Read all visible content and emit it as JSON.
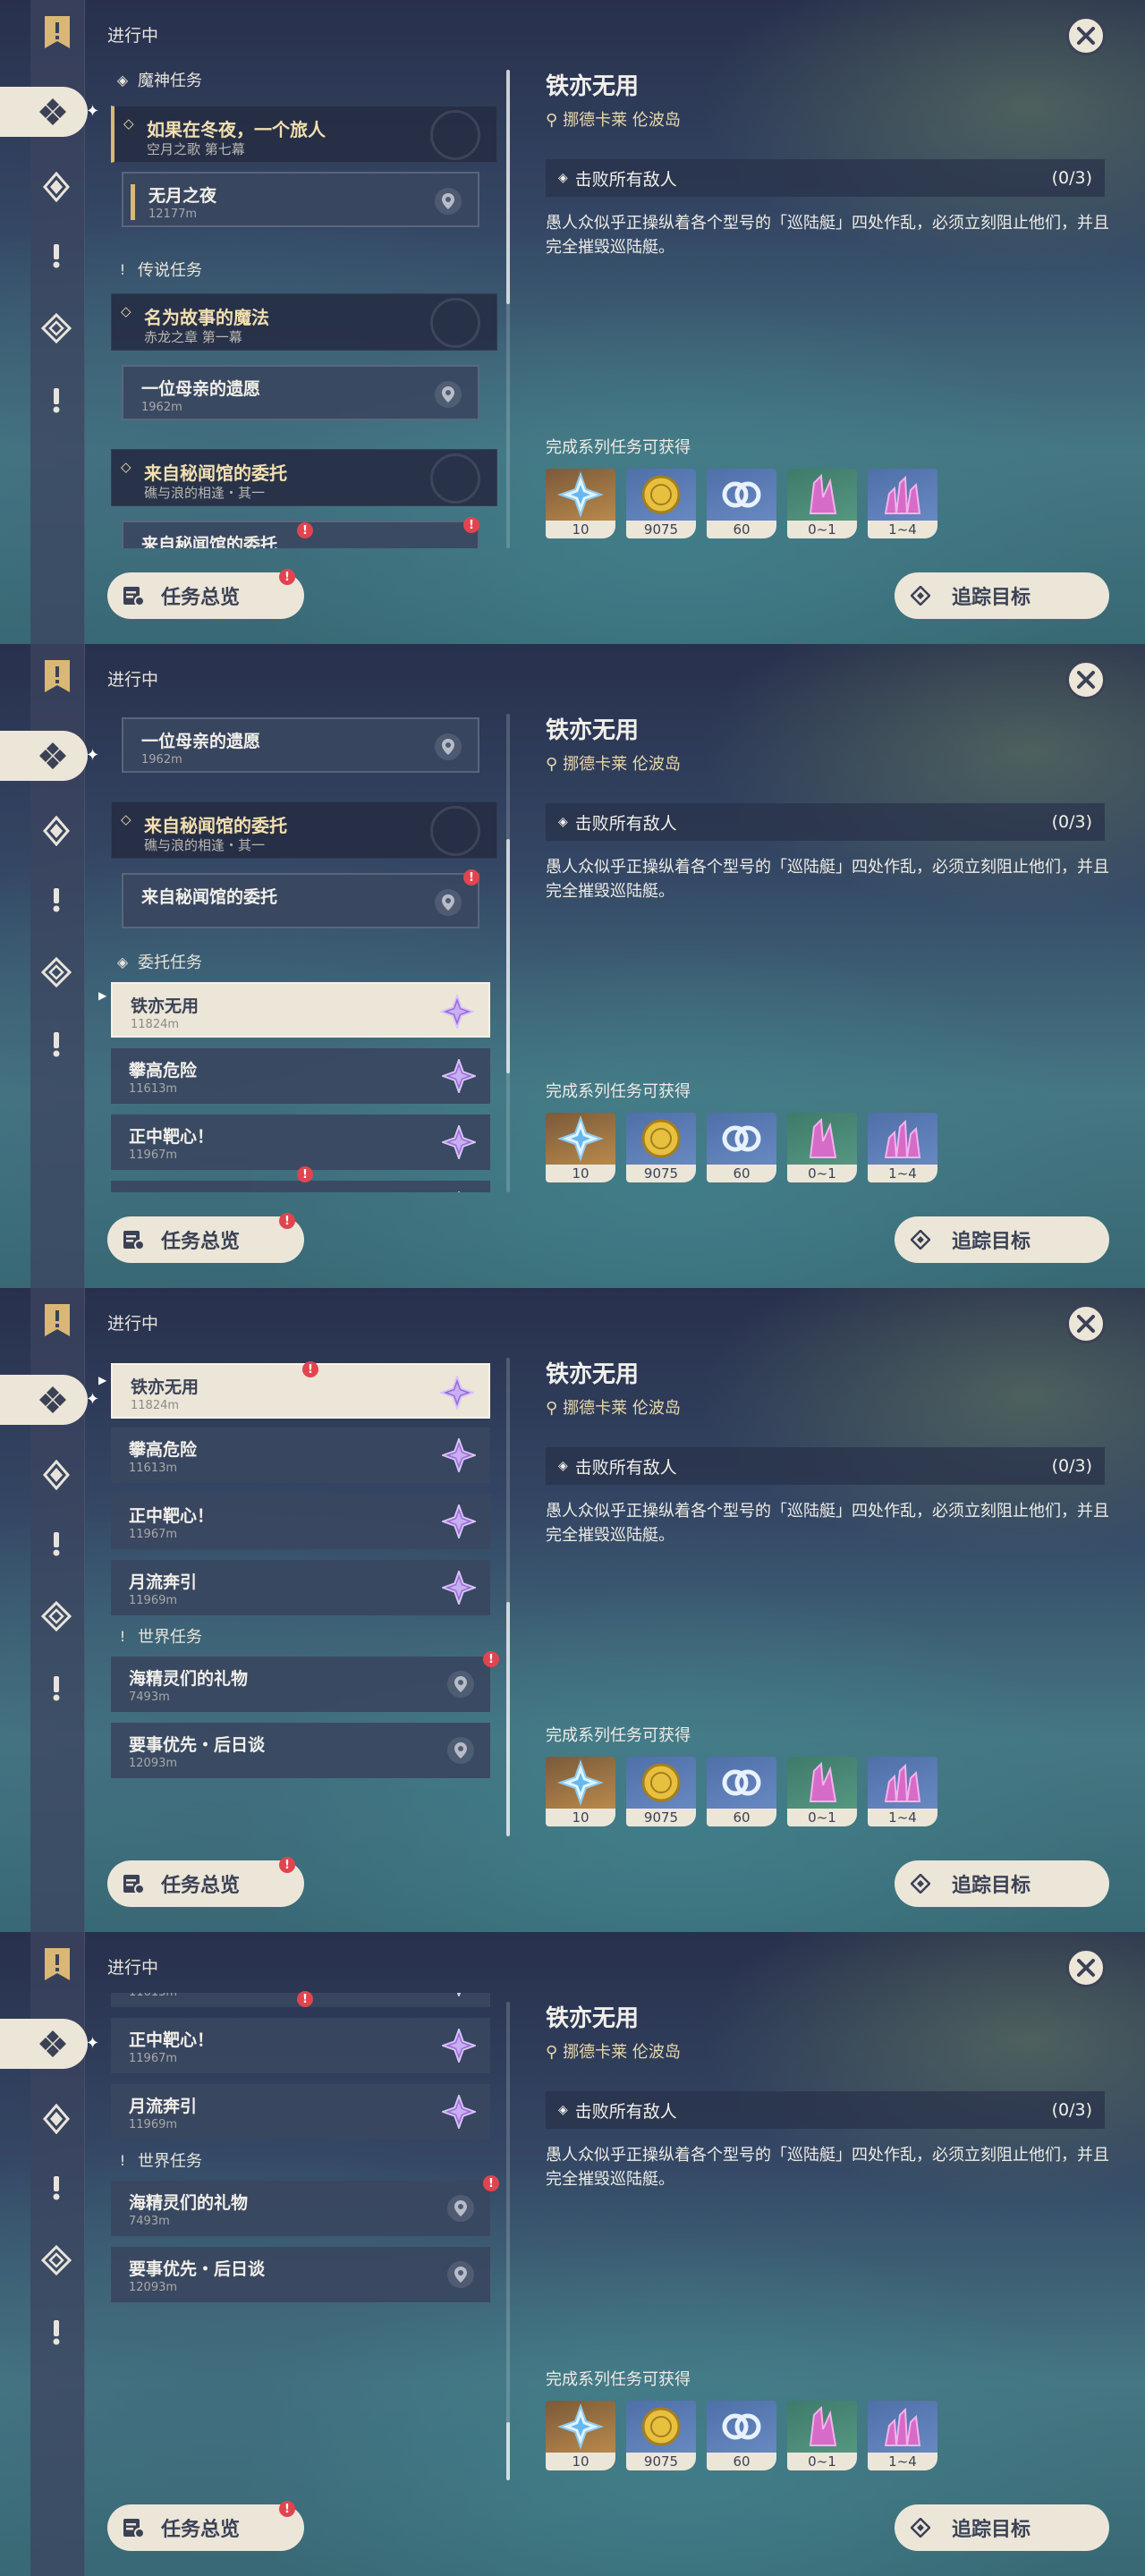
{
  "header": {
    "in_progress": "进行中"
  },
  "sections": {
    "archon": "魔神任务",
    "story": "传说任务",
    "commission": "委托任务",
    "world": "世界任务"
  },
  "quests": {
    "archon_chain": {
      "name": "如果在冬夜，一个旅人",
      "sub": "空月之歌 第七幕"
    },
    "archon_step": {
      "name": "无月之夜",
      "dist": "12177m"
    },
    "story_chain": {
      "name": "名为故事的魔法",
      "sub": "赤龙之章 第一幕"
    },
    "story_step": {
      "name": "一位母亲的遗愿",
      "dist": "1962m"
    },
    "hangout_chain": {
      "name": "来自秘闻馆的委托",
      "sub": "礁与浪的相逢・其一"
    },
    "hangout_step": {
      "name": "来自秘闻馆的委托"
    },
    "c1": {
      "name": "铁亦无用",
      "dist": "11824m"
    },
    "c2": {
      "name": "攀高危险",
      "dist": "11613m"
    },
    "c3": {
      "name": "正中靶心！",
      "dist": "11967m"
    },
    "c4": {
      "name": "月流奔引",
      "dist": "11969m"
    },
    "w1": {
      "name": "海精灵们的礼物",
      "dist": "7493m"
    },
    "w2": {
      "name": "要事优先・后日谈",
      "dist": "12093m"
    }
  },
  "notif_mark": "!",
  "buttons": {
    "overview": "任务总览",
    "track": "追踪目标"
  },
  "detail": {
    "title": "铁亦无用",
    "location": "挪德卡莱 伦波岛",
    "objective": "击败所有敌人",
    "progress": "(0/3)",
    "description": "愚人众似乎正操纵着各个型号的「巡陆艇」四处作乱，必须立刻阻止他们，并且完全摧毁巡陆艇。",
    "rewards_label": "完成系列任务可获得",
    "rewards": [
      {
        "icon": "primogem-icon",
        "qty": "10"
      },
      {
        "icon": "mora-icon",
        "qty": "9075"
      },
      {
        "icon": "companionship-exp-icon",
        "qty": "60"
      },
      {
        "icon": "crystal-icon",
        "qty": "0~1"
      },
      {
        "icon": "crystal-cluster-icon",
        "qty": "1~4"
      }
    ]
  },
  "colors": {
    "accent": "#ece6d8",
    "gold": "#d8b874",
    "notif": "#e0454f",
    "panel": "#3a4660"
  }
}
